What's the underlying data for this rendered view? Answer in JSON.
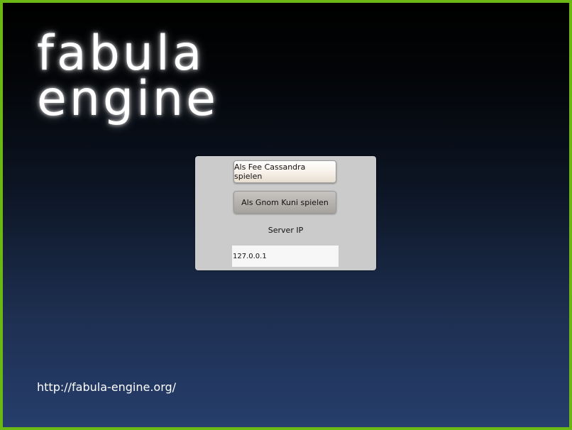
{
  "app": {
    "logo_line1": "fabula",
    "logo_line2": "engine",
    "url": "http://fabula-engine.org/"
  },
  "colors": {
    "frame_border": "#6bb814",
    "background_top": "#000000",
    "background_bottom": "#263e6c",
    "panel": "#cbcbcb"
  },
  "panel": {
    "button_fee_label": "Als Fee Cassandra spielen",
    "button_gnom_label": "Als Gnom Kuni spielen",
    "server_ip_label": "Server IP",
    "server_ip_value": "127.0.0.1"
  }
}
